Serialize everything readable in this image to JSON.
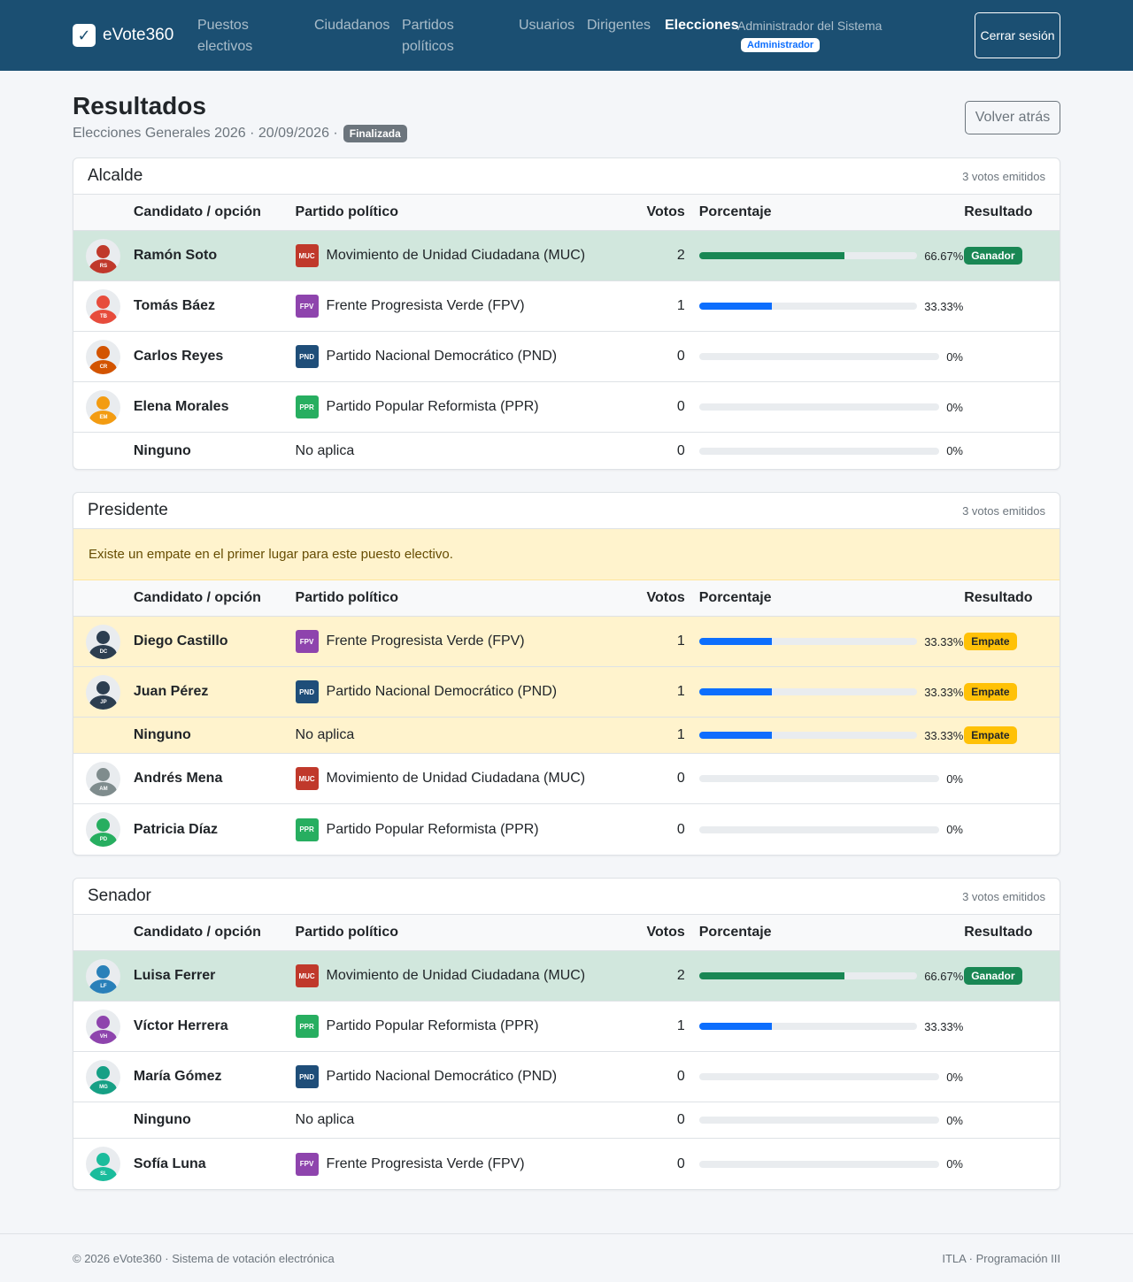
{
  "nav": {
    "brand": "eVote360",
    "brand_icon": "check-icon",
    "links": [
      {
        "label": "Puestos electivos",
        "active": false
      },
      {
        "label": "Ciudadanos",
        "active": false
      },
      {
        "label": "Partidos políticos",
        "active": false
      },
      {
        "label": "Usuarios",
        "active": false
      },
      {
        "label": "Dirigentes",
        "active": false
      },
      {
        "label": "Elecciones",
        "active": true
      }
    ],
    "user_name": "Administrador del Sistema",
    "user_role": "Administrador",
    "logout_label": "Cerrar sesión"
  },
  "header": {
    "title": "Resultados",
    "subtitle": "Elecciones Generales 2026 · 20/09/2026 ·",
    "status": "Finalizada",
    "back_label": "Volver atrás"
  },
  "table_headers": {
    "candidate": "Candidato / opción",
    "party": "Partido político",
    "votes": "Votos",
    "percent": "Porcentaje",
    "result": "Resultado"
  },
  "colors": {
    "navbar": "#1b4f72",
    "winner_row": "#d1e7dd",
    "tie_row": "#fff3cd",
    "bar_winner": "#198754",
    "bar_normal": "#0d6efd",
    "badge_win": "#198754",
    "badge_tie": "#ffc107"
  },
  "parties": {
    "MUC": {
      "name": "Movimiento de Unidad Ciudadana (MUC)",
      "color": "#c0392b"
    },
    "FPV": {
      "name": "Frente Progresista Verde (FPV)",
      "color": "#8e44ad"
    },
    "PND": {
      "name": "Partido Nacional Democrático (PND)",
      "color": "#1f4e79"
    },
    "PPR": {
      "name": "Partido Popular Reformista (PPR)",
      "color": "#27ae60"
    }
  },
  "sections": [
    {
      "title": "Alcalde",
      "count": "3 votos emitidos",
      "alert": "",
      "rows": [
        {
          "name": "Ramón Soto",
          "initials": "RS",
          "avatar_color": "#c0392b",
          "party": "MUC",
          "votes": "2",
          "percent": 66.67,
          "percent_label": "66.67%",
          "result": "Ganador",
          "state": "winner"
        },
        {
          "name": "Tomás Báez",
          "initials": "TB",
          "avatar_color": "#e74c3c",
          "party": "FPV",
          "votes": "1",
          "percent": 33.33,
          "percent_label": "33.33%",
          "result": "",
          "state": ""
        },
        {
          "name": "Carlos Reyes",
          "initials": "CR",
          "avatar_color": "#d35400",
          "party": "PND",
          "votes": "0",
          "percent": 0,
          "percent_label": "0%",
          "result": "",
          "state": ""
        },
        {
          "name": "Elena Morales",
          "initials": "EM",
          "avatar_color": "#f39c12",
          "party": "PPR",
          "votes": "0",
          "percent": 0,
          "percent_label": "0%",
          "result": "",
          "state": ""
        },
        {
          "name": "Ninguno",
          "initials": "",
          "avatar_color": "",
          "party": "",
          "party_text": "No aplica",
          "votes": "0",
          "percent": 0,
          "percent_label": "0%",
          "result": "",
          "state": ""
        }
      ]
    },
    {
      "title": "Presidente",
      "count": "3 votos emitidos",
      "alert": "Existe un empate en el primer lugar para este puesto electivo.",
      "rows": [
        {
          "name": "Diego Castillo",
          "initials": "DC",
          "avatar_color": "#2c3e50",
          "party": "FPV",
          "votes": "1",
          "percent": 33.33,
          "percent_label": "33.33%",
          "result": "Empate",
          "state": "tie"
        },
        {
          "name": "Juan Pérez",
          "initials": "JP",
          "avatar_color": "#2c3e50",
          "party": "PND",
          "votes": "1",
          "percent": 33.33,
          "percent_label": "33.33%",
          "result": "Empate",
          "state": "tie"
        },
        {
          "name": "Ninguno",
          "initials": "",
          "avatar_color": "",
          "party": "",
          "party_text": "No aplica",
          "votes": "1",
          "percent": 33.33,
          "percent_label": "33.33%",
          "result": "Empate",
          "state": "tie"
        },
        {
          "name": "Andrés Mena",
          "initials": "AM",
          "avatar_color": "#7f8c8d",
          "party": "MUC",
          "votes": "0",
          "percent": 0,
          "percent_label": "0%",
          "result": "",
          "state": ""
        },
        {
          "name": "Patricia Díaz",
          "initials": "PD",
          "avatar_color": "#27ae60",
          "party": "PPR",
          "votes": "0",
          "percent": 0,
          "percent_label": "0%",
          "result": "",
          "state": ""
        }
      ]
    },
    {
      "title": "Senador",
      "count": "3 votos emitidos",
      "alert": "",
      "rows": [
        {
          "name": "Luisa Ferrer",
          "initials": "LF",
          "avatar_color": "#2980b9",
          "party": "MUC",
          "votes": "2",
          "percent": 66.67,
          "percent_label": "66.67%",
          "result": "Ganador",
          "state": "winner"
        },
        {
          "name": "Víctor Herrera",
          "initials": "VH",
          "avatar_color": "#8e44ad",
          "party": "PPR",
          "votes": "1",
          "percent": 33.33,
          "percent_label": "33.33%",
          "result": "",
          "state": ""
        },
        {
          "name": "María Gómez",
          "initials": "MG",
          "avatar_color": "#16a085",
          "party": "PND",
          "votes": "0",
          "percent": 0,
          "percent_label": "0%",
          "result": "",
          "state": ""
        },
        {
          "name": "Ninguno",
          "initials": "",
          "avatar_color": "",
          "party": "",
          "party_text": "No aplica",
          "votes": "0",
          "percent": 0,
          "percent_label": "0%",
          "result": "",
          "state": ""
        },
        {
          "name": "Sofía Luna",
          "initials": "SL",
          "avatar_color": "#1abc9c",
          "party": "FPV",
          "votes": "0",
          "percent": 0,
          "percent_label": "0%",
          "result": "",
          "state": ""
        }
      ]
    }
  ],
  "footer": {
    "left": "© 2026 eVote360 · Sistema de votación electrónica",
    "right": "ITLA · Programación III"
  }
}
